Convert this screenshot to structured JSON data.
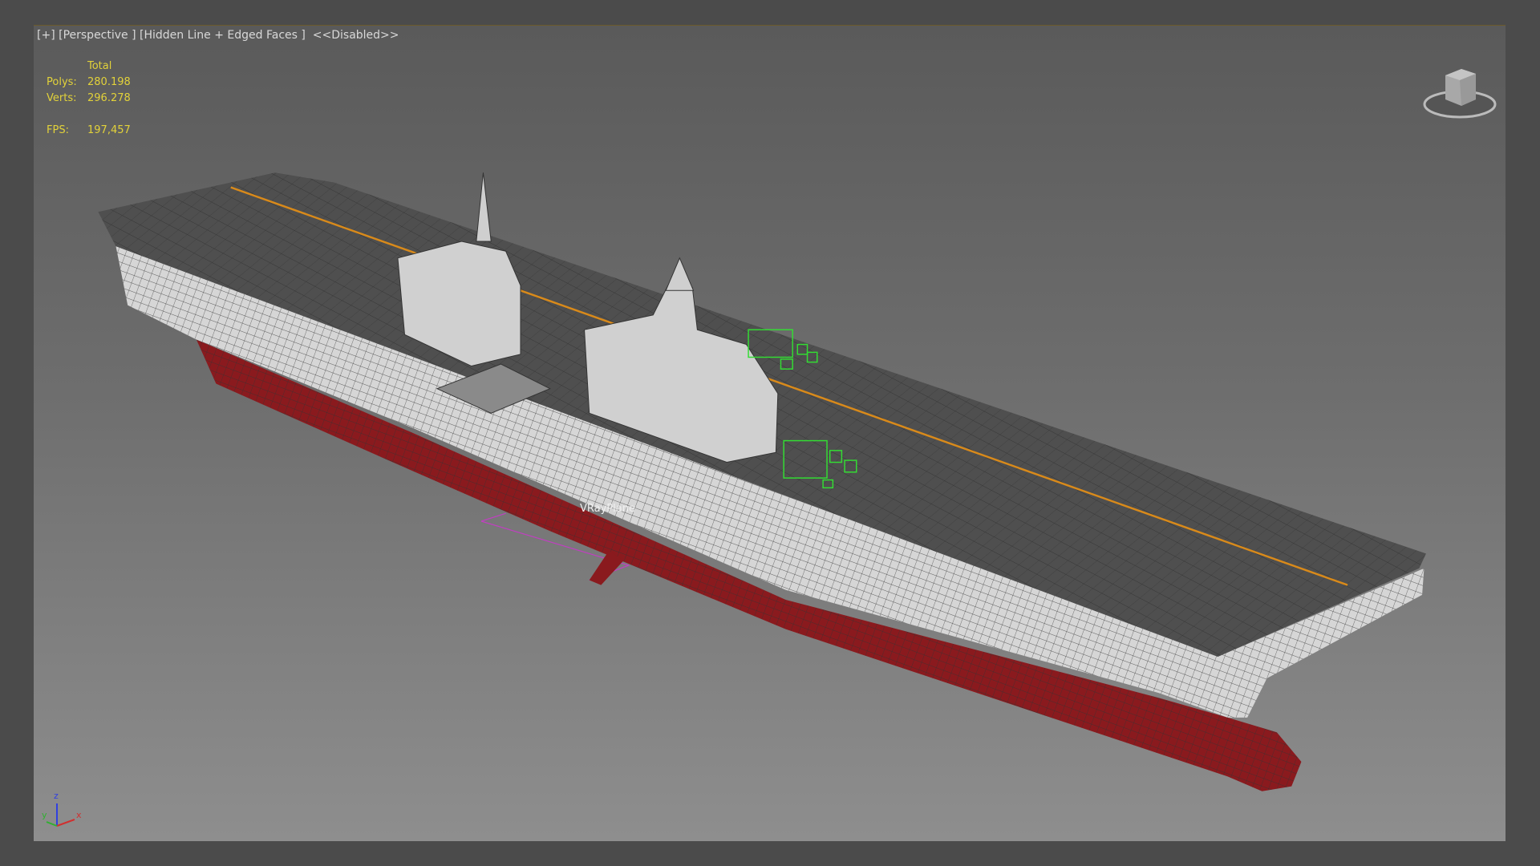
{
  "viewport": {
    "menu": "[+]",
    "view": "[Perspective ]",
    "shading": "[Hidden Line + Edged Faces ]",
    "mode": "<<Disabled>>"
  },
  "stats": {
    "header": "Total",
    "polys_label": "Polys:",
    "polys": "280.198",
    "verts_label": "Verts:",
    "verts": "296.278",
    "fps_label": "FPS:",
    "fps": "197,457"
  },
  "scene": {
    "object_label": "VRayPlane",
    "colors": {
      "deck": "#4e4e4e",
      "hull_white": "#d8d8d8",
      "hull_red": "#8a1a1e",
      "deck_line": "#d98a1a",
      "helper": "#33dd33",
      "vray": "#c040c0"
    }
  },
  "axis_gizmo": {
    "x": "x",
    "y": "y",
    "z": "z"
  }
}
